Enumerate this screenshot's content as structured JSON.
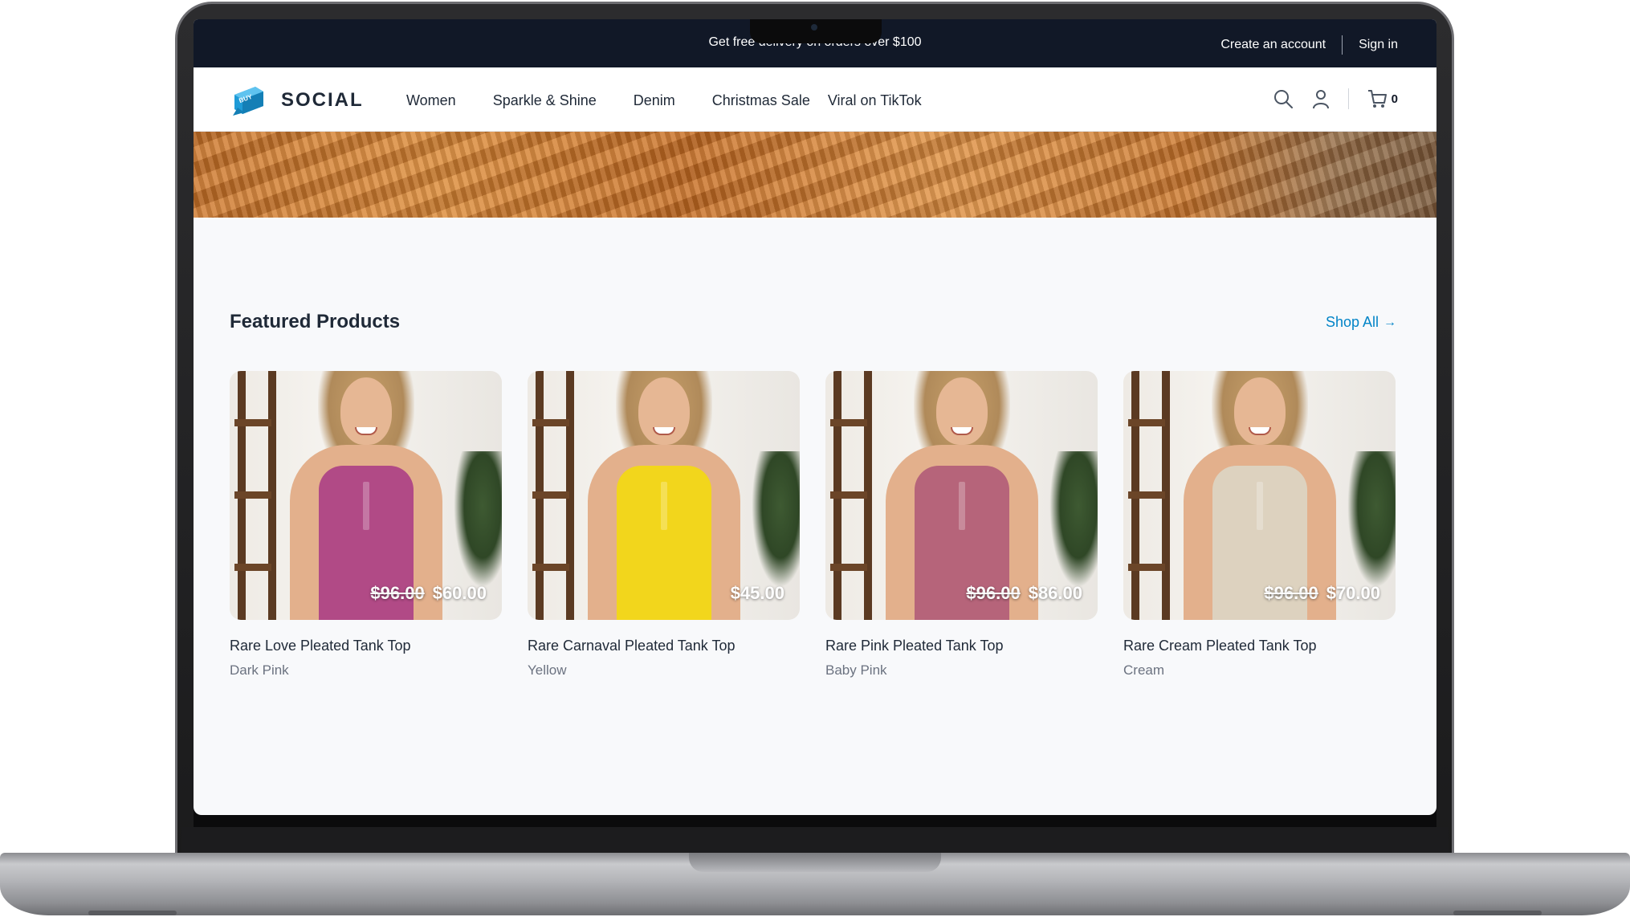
{
  "announcement": {
    "message": "Get free delivery on orders over $100",
    "create_account": "Create an account",
    "sign_in": "Sign in"
  },
  "header": {
    "logo_text": "SOCIAL",
    "logo_badge": "BUY",
    "nav": [
      "Women",
      "Sparkle & Shine",
      "Denim",
      "Christmas Sale",
      "Viral on TikTok"
    ],
    "cart_count": "0",
    "icons": [
      "search-icon",
      "user-icon",
      "cart-icon"
    ]
  },
  "featured": {
    "title": "Featured Products",
    "shop_all": "Shop All",
    "shop_all_arrow": "→",
    "products": [
      {
        "name": "Rare Love Pleated Tank Top",
        "color": "Dark Pink",
        "old_price": "$96.00",
        "price": "$60.00",
        "tank_color": "#b14a86"
      },
      {
        "name": "Rare Carnaval Pleated Tank Top",
        "color": "Yellow",
        "old_price": "",
        "price": "$45.00",
        "tank_color": "#f2d61c"
      },
      {
        "name": "Rare Pink Pleated Tank Top",
        "color": "Baby Pink",
        "old_price": "$96.00",
        "price": "$86.00",
        "tank_color": "#b6647a"
      },
      {
        "name": "Rare Cream Pleated Tank Top",
        "color": "Cream",
        "old_price": "$96.00",
        "price": "$70.00",
        "tank_color": "#ddd2bf"
      }
    ]
  },
  "colors": {
    "announcement_bg": "#111827",
    "accent_link": "#0284c7",
    "logo_blue": "#1e9bd7",
    "page_bg": "#f8f9fb"
  }
}
